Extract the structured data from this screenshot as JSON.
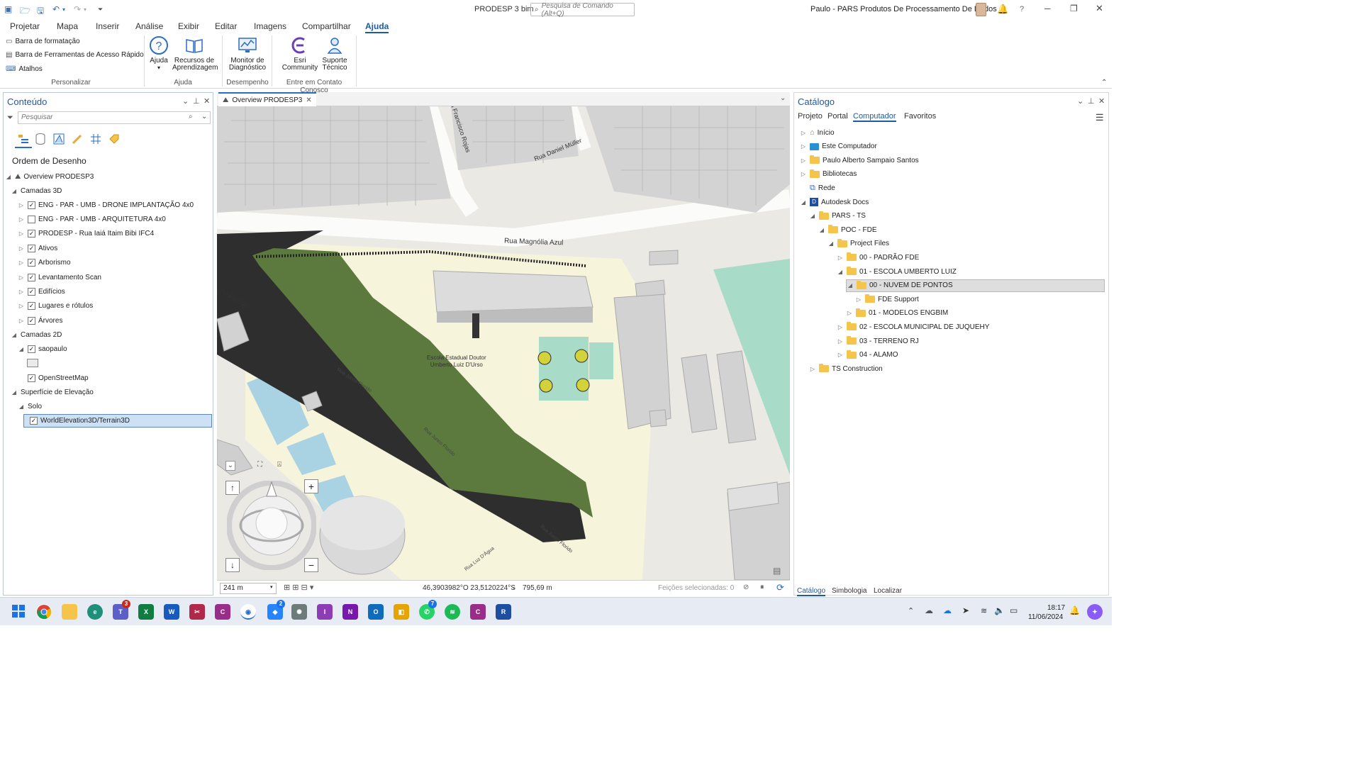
{
  "app": {
    "title": "PRODESP 3 bim",
    "search_placeholder": "Pesquisa de Comando (Alt+Q)",
    "user": "Paulo - PARS Produtos De Processamento De Dados"
  },
  "menu": [
    "Projetar",
    "Mapa",
    "Inserir",
    "Análise",
    "Exibir",
    "Editar",
    "Imagens",
    "Compartilhar",
    "Ajuda"
  ],
  "ribbon": {
    "personalizar": {
      "items": [
        "Barra de formatação",
        "Barra de Ferramentas de Acesso Rápido",
        "Atalhos"
      ],
      "label": "Personalizar"
    },
    "ajuda": {
      "ajuda": "Ajuda",
      "recursos1": "Recursos de",
      "recursos2": "Aprendizagem",
      "label": "Ajuda"
    },
    "desempenho": {
      "monitor1": "Monitor de",
      "monitor2": "Diagnóstico",
      "label": "Desempenho"
    },
    "contato": {
      "esri1": "Esri",
      "esri2": "Community",
      "sup1": "Suporte",
      "sup2": "Técnico",
      "label": "Entre em Contato Conosco"
    }
  },
  "contents": {
    "title": "Conteúdo",
    "search_placeholder": "Pesquisar",
    "section": "Ordem de Desenho",
    "map": "Overview PRODESP3",
    "layers3d": "Camadas 3D",
    "layers3d_items": [
      {
        "label": "ENG - PAR - UMB - DRONE IMPLANTAÇÃO 4x0",
        "checked": true
      },
      {
        "label": "ENG - PAR - UMB - ARQUITETURA 4x0",
        "checked": false
      },
      {
        "label": "PRODESP - Rua Iaiá Itaim Bibi IFC4",
        "checked": true
      },
      {
        "label": "Ativos",
        "checked": true
      },
      {
        "label": "Arborismo",
        "checked": true
      },
      {
        "label": "Levantamento Scan",
        "checked": true
      },
      {
        "label": "Edifícios",
        "checked": true
      },
      {
        "label": "Lugares e rótulos",
        "checked": true
      },
      {
        "label": "Árvores",
        "checked": true
      }
    ],
    "layers2d": "Camadas 2D",
    "saopaulo": "saopaulo",
    "osm": "OpenStreetMap",
    "elevation": "Superfície de Elevação",
    "solo": "Solo",
    "terrain": "WorldElevation3D/Terrain3D"
  },
  "map": {
    "tab": "Overview PRODESP3",
    "labels": {
      "magnolia": "Rua Magnólia Azul",
      "daniel": "Rua Daniel Müller",
      "francisco": "Rua Francisco Rojas",
      "florido": "Rua Junco Florido",
      "florido2": "Rua Junco Florido",
      "florido3": "Rua Junco Florido",
      "florido_left": "no Florido",
      "agua": "Rua Luz D'Água",
      "school1": "Escola Estadual Doutor",
      "school2": "Umberto Luiz D'Urso"
    },
    "scale": "241 m",
    "coords": "46,3903982°O 23,5120224°S",
    "elevation": "795,69 m",
    "selected": "Feições selecionadas: 0"
  },
  "catalog": {
    "title": "Catálogo",
    "tabs": [
      "Projeto",
      "Portal",
      "Computador",
      "Favoritos"
    ],
    "tree": [
      {
        "label": "Início",
        "level": 0,
        "icon": "home",
        "arrow": "right"
      },
      {
        "label": "Este Computador",
        "level": 0,
        "icon": "pc",
        "arrow": "right"
      },
      {
        "label": "Paulo Alberto Sampaio Santos",
        "level": 0,
        "icon": "folder",
        "arrow": "right"
      },
      {
        "label": "Bibliotecas",
        "level": 0,
        "icon": "folder",
        "arrow": "right"
      },
      {
        "label": "Rede",
        "level": 0,
        "icon": "net",
        "arrow": ""
      },
      {
        "label": "Autodesk Docs",
        "level": 0,
        "icon": "docs",
        "arrow": "down"
      },
      {
        "label": "PARS - TS",
        "level": 1,
        "icon": "folder",
        "arrow": "down"
      },
      {
        "label": "POC - FDE",
        "level": 2,
        "icon": "folder",
        "arrow": "down"
      },
      {
        "label": "Project Files",
        "level": 3,
        "icon": "folder",
        "arrow": "down"
      },
      {
        "label": "00 - PADRÃO FDE",
        "level": 4,
        "icon": "folder",
        "arrow": "right"
      },
      {
        "label": "01 - ESCOLA UMBERTO LUIZ",
        "level": 4,
        "icon": "folder",
        "arrow": "down"
      },
      {
        "label": "00 - NUVEM DE PONTOS",
        "level": 5,
        "icon": "folder",
        "arrow": "down",
        "selected": true
      },
      {
        "label": "FDE Support",
        "level": 6,
        "icon": "folder",
        "arrow": "right"
      },
      {
        "label": "01 - MODELOS ENGBIM",
        "level": 5,
        "icon": "folder",
        "arrow": "right"
      },
      {
        "label": "02 - ESCOLA MUNICIPAL DE JUQUEHY",
        "level": 4,
        "icon": "folder",
        "arrow": "right"
      },
      {
        "label": "03 - TERRENO RJ",
        "level": 4,
        "icon": "folder",
        "arrow": "right"
      },
      {
        "label": "04 - ALAMO",
        "level": 4,
        "icon": "folder",
        "arrow": "right"
      },
      {
        "label": "TS Construction",
        "level": 1,
        "icon": "folder",
        "arrow": "right"
      }
    ],
    "bottom_tabs": [
      "Catálogo",
      "Simbologia",
      "Localizar"
    ]
  },
  "taskbar": {
    "time": "18:17",
    "date": "11/06/2024",
    "badges": {
      "teams": "3",
      "jira": "2",
      "whatsapp": "7"
    }
  }
}
